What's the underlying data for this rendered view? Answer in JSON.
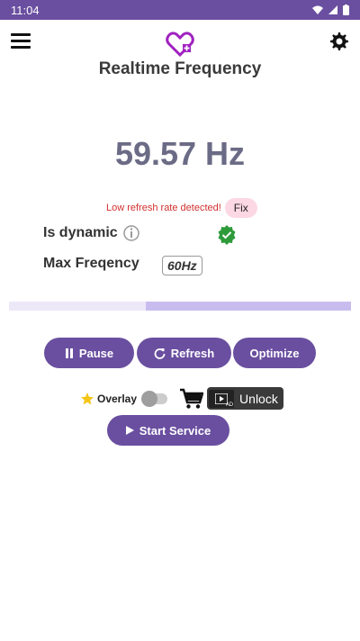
{
  "status_bar": {
    "time": "11:04"
  },
  "header": {
    "title": "Realtime Frequency",
    "menu_icon": "hamburger-menu-icon",
    "logo_icon": "heart-plus-icon",
    "settings_icon": "gear-icon"
  },
  "frequency": {
    "value": "59.57 Hz"
  },
  "warning": {
    "text": "Low refresh rate detected!",
    "fix_label": "Fix"
  },
  "info": {
    "dynamic_label": "Is dynamic",
    "max_label": "Max Freqency",
    "max_value": "60Hz",
    "dynamic_ok": true
  },
  "progress": {
    "fraction": 0.6
  },
  "controls": {
    "pause_label": "Pause",
    "refresh_label": "Refresh",
    "optimize_label": "Optimize"
  },
  "overlay": {
    "label": "Overlay",
    "enabled": false,
    "unlock_label": "Unlock",
    "ad_badge": "AD"
  },
  "service": {
    "start_label": "Start Service"
  },
  "colors": {
    "primary": "#6a4fa0",
    "warning": "#d32f2f",
    "check": "#2e9b3b"
  }
}
